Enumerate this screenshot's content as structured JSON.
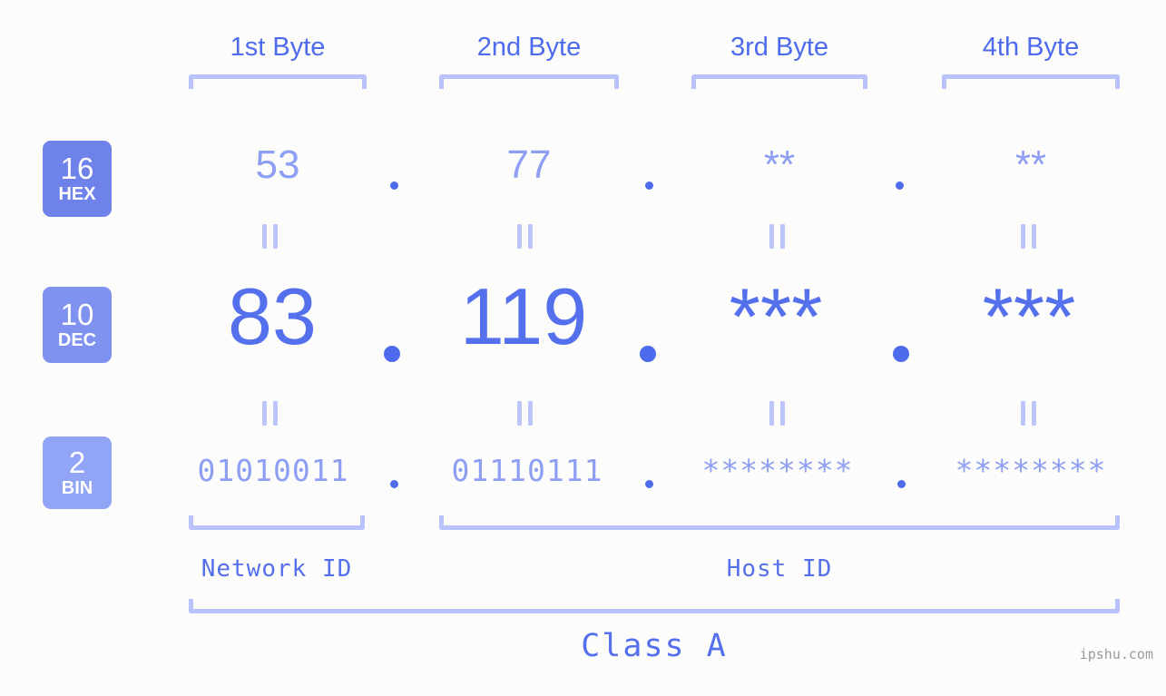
{
  "header": {
    "byte_labels": [
      "1st Byte",
      "2nd Byte",
      "3rd Byte",
      "4th Byte"
    ]
  },
  "radix_badges": [
    {
      "number": "16",
      "name": "HEX",
      "color": "#6f82ea"
    },
    {
      "number": "10",
      "name": "DEC",
      "color": "#7f92f0"
    },
    {
      "number": "2",
      "name": "BIN",
      "color": "#92a4f6"
    }
  ],
  "rows": {
    "hex": {
      "octets": [
        "53",
        "77",
        "**",
        "**"
      ]
    },
    "dec": {
      "octets": [
        "83",
        "119",
        "***",
        "***"
      ]
    },
    "bin": {
      "octets": [
        "01010011",
        "01110111",
        "********",
        "********"
      ]
    }
  },
  "separator": {
    "dot": "."
  },
  "equals_marker": "||",
  "sections": {
    "network_id": "Network ID",
    "host_id": "Host ID",
    "class": "Class A"
  },
  "watermark": "ipshu.com",
  "colors": {
    "background": "#fcfdfa",
    "accent_strong": "#4d6bec",
    "accent_value": "#5570ec",
    "accent_light": "#8e9ef3",
    "bracket": "#b9c2fb"
  }
}
